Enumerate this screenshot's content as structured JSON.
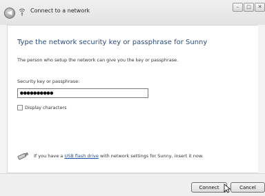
{
  "window": {
    "title": "Connect to a network"
  },
  "caption_buttons": {
    "minimize": "–",
    "maximize": "□",
    "close": "✕"
  },
  "main": {
    "heading": "Type the network security key or passphrase for Sunny",
    "info": "The person who setup the network can give you the key or passphrase.",
    "key_label": "Security key or passphrase:",
    "key_value": "●●●●●●●●●●",
    "display_characters_label": "Display characters",
    "display_characters_checked": false,
    "usb_text_before": "If you have a ",
    "usb_link": "USB flash drive",
    "usb_text_after": " with network settings for Sunny, insert it now."
  },
  "footer": {
    "connect_label": "Connect",
    "cancel_label": "Cancel"
  },
  "icons": {
    "back": "back-arrow-icon",
    "network": "network-icon",
    "usb": "usb-drive-icon",
    "cursor": "mouse-pointer-icon"
  }
}
